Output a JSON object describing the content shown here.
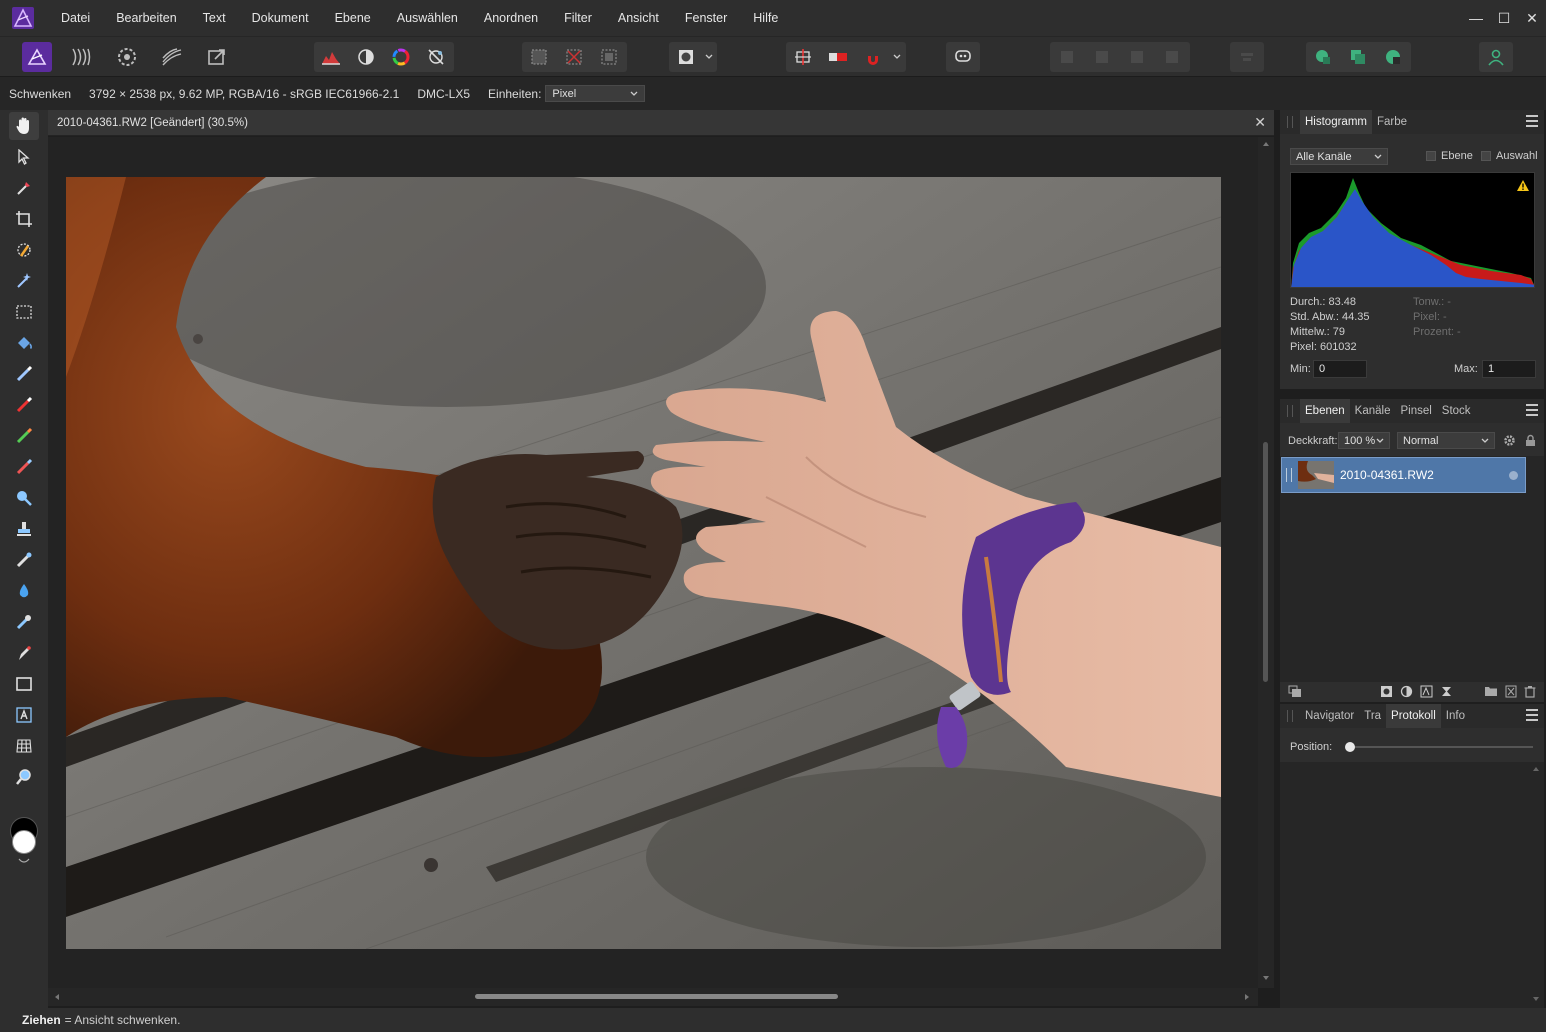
{
  "menu": [
    "Datei",
    "Bearbeiten",
    "Text",
    "Dokument",
    "Ebene",
    "Auswählen",
    "Anordnen",
    "Filter",
    "Ansicht",
    "Fenster",
    "Hilfe"
  ],
  "window": {
    "minimize": "—",
    "maximize": "☐",
    "close": "✕"
  },
  "context": {
    "tool": "Schwenken",
    "image_info": "3792 × 2538 px, 9.62 MP, RGBA/16 - sRGB IEC61966-2.1",
    "camera": "DMC-LX5",
    "units_label": "Einheiten:",
    "units_value": "Pixel"
  },
  "document": {
    "title": "2010-04361.RW2 [Geändert] (30.5%)",
    "close": "✕"
  },
  "status": {
    "key": "Ziehen",
    "desc": "= Ansicht schwenken."
  },
  "histogram": {
    "tabs": [
      "Histogramm",
      "Farbe"
    ],
    "channel": "Alle Kanäle",
    "layer_label": "Ebene",
    "selection_label": "Auswahl",
    "warning": "!",
    "stats": {
      "mean": "Durch.: 83.48",
      "std": "Std. Abw.: 44.35",
      "median": "Mittelw.: 79",
      "pixels": "Pixel: 601032",
      "tone": "Tonw.: -",
      "pixel_r": "Pixel: -",
      "percent": "Prozent: -"
    },
    "min_label": "Min:",
    "min_value": "0",
    "max_label": "Max:",
    "max_value": "1"
  },
  "layers": {
    "tabs": [
      "Ebenen",
      "Kanäle",
      "Pinsel",
      "Stock"
    ],
    "opacity_label": "Deckkraft:",
    "opacity_value": "100 %",
    "blend_mode": "Normal",
    "items": [
      {
        "name": "2010-04361.RW2"
      }
    ]
  },
  "history": {
    "tabs": [
      "Navigator",
      "Tra",
      "Protokoll",
      "Info"
    ],
    "position_label": "Position:",
    "position": 0
  },
  "colors": {
    "accent": "#7d3fd6",
    "layer_selected": "#4f77a8",
    "warning": "#f5c518"
  }
}
